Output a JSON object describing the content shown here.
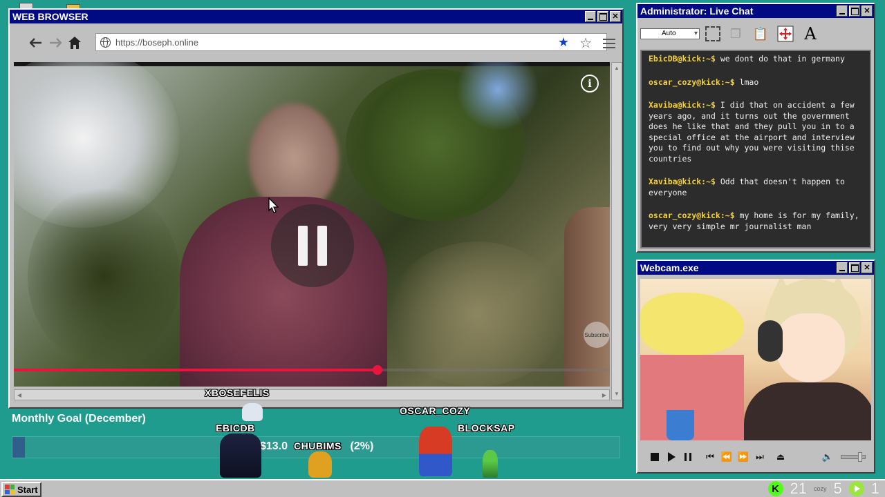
{
  "browser": {
    "title": "WEB BROWSER",
    "url": "https://boseph.online",
    "video": {
      "progress_fraction": 0.61,
      "subscribe_badge": "Subscribe"
    }
  },
  "chat": {
    "title": "Administrator: Live Chat",
    "font_select": "Auto",
    "messages": [
      {
        "user": "EbicDB@kick:~$",
        "text": " we dont do that in germany"
      },
      {
        "user": "oscar_cozy@kick:~$",
        "text": " lmao"
      },
      {
        "user": "Xaviba@kick:~$",
        "text": " I did that on accident a few years ago, and it turns out the government does he like that and they pull you in to a special office at the airport and interview you to find out why you were visiting thise countries"
      },
      {
        "user": "Xaviba@kick:~$",
        "text": " Odd that doesn't happen to everyone"
      },
      {
        "user": "oscar_cozy@kick:~$",
        "text": " my home is for my family, very very simple mr journalist man"
      }
    ]
  },
  "webcam": {
    "title": "Webcam.exe"
  },
  "goal": {
    "title": "Monthly Goal (December)",
    "amount_text": "$13.0",
    "percent_text": "(2%)",
    "progress_fraction": 0.02
  },
  "avatars": {
    "a1": "XBOSEFELIS",
    "a2": "EBICDB",
    "a3": "CHUBIMS",
    "a4": "OSCAR_COZY",
    "a5": "BLOCKSAP"
  },
  "taskbar": {
    "start_label": "Start",
    "viewers": "21",
    "cozy_label": "cozy",
    "count_b": "5",
    "count_c": "1"
  },
  "colors": {
    "desktop": "#1f9c8e",
    "titlebar": "#000a83",
    "progress": "#e8163f",
    "chat_user": "#f5d13a",
    "kick_green": "#53fc18"
  }
}
